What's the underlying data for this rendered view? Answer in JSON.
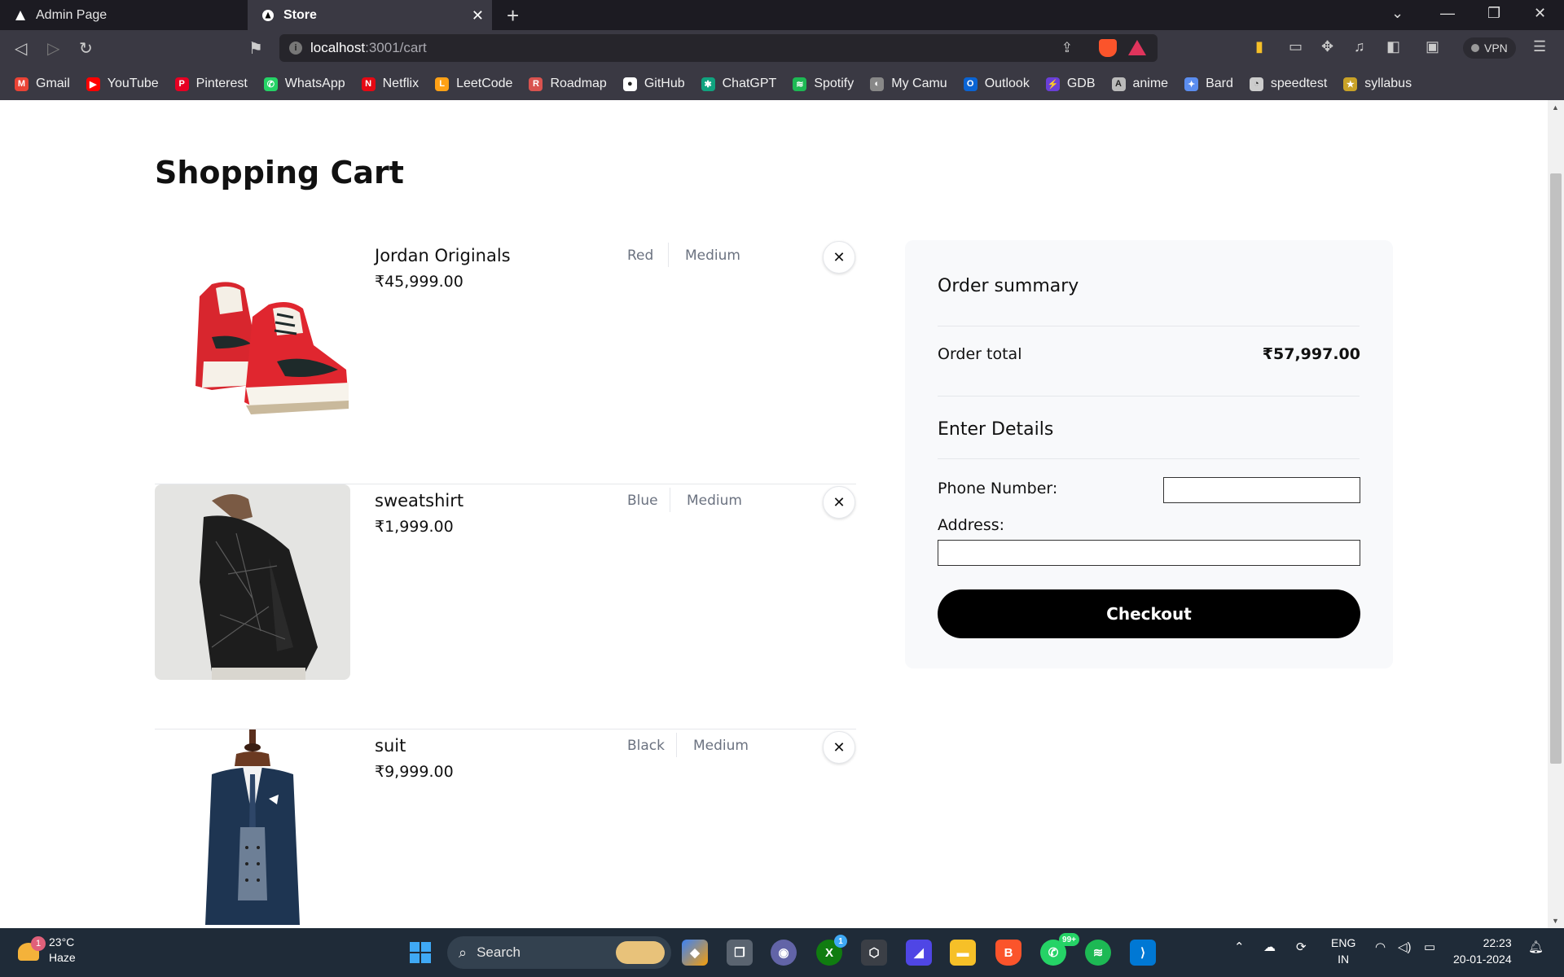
{
  "browser": {
    "tabs": [
      {
        "title": "Admin Page",
        "active": false
      },
      {
        "title": "Store",
        "active": true
      }
    ],
    "url_host": "localhost",
    "url_path": ":3001/cart",
    "vpn_label": "VPN",
    "bookmarks": [
      {
        "label": "Gmail",
        "color": "#ea4335",
        "glyph": "M"
      },
      {
        "label": "YouTube",
        "color": "#ff0000",
        "glyph": "▶"
      },
      {
        "label": "Pinterest",
        "color": "#e60023",
        "glyph": "P"
      },
      {
        "label": "WhatsApp",
        "color": "#25d366",
        "glyph": "✆"
      },
      {
        "label": "Netflix",
        "color": "#e50914",
        "glyph": "N"
      },
      {
        "label": "LeetCode",
        "color": "#ffa116",
        "glyph": "L"
      },
      {
        "label": "Roadmap",
        "color": "#d9534f",
        "glyph": "R"
      },
      {
        "label": "GitHub",
        "color": "#ffffff",
        "glyph": "●"
      },
      {
        "label": "ChatGPT",
        "color": "#10a37f",
        "glyph": "✱"
      },
      {
        "label": "Spotify",
        "color": "#1db954",
        "glyph": "≋"
      },
      {
        "label": "My Camu",
        "color": "#888888",
        "glyph": "◐"
      },
      {
        "label": "Outlook",
        "color": "#0a64d4",
        "glyph": "O"
      },
      {
        "label": "GDB",
        "color": "#6a3fd8",
        "glyph": "⚡"
      },
      {
        "label": "anime",
        "color": "#bbbbbb",
        "glyph": "A"
      },
      {
        "label": "Bard",
        "color": "#5b8def",
        "glyph": "✦"
      },
      {
        "label": "speedtest",
        "color": "#cccccc",
        "glyph": "◔"
      },
      {
        "label": "syllabus",
        "color": "#c9a227",
        "glyph": "★"
      }
    ]
  },
  "page": {
    "title": "Shopping Cart",
    "items": [
      {
        "name": "Jordan Originals",
        "price": "₹45,999.00",
        "color": "Red",
        "size": "Medium",
        "image": "sneakers"
      },
      {
        "name": "sweatshirt",
        "price": "₹1,999.00",
        "color": "Blue",
        "size": "Medium",
        "image": "sweatshirt"
      },
      {
        "name": "suit",
        "price": "₹9,999.00",
        "color": "Black",
        "size": "Medium",
        "image": "suit"
      }
    ],
    "remove_glyph": "✕",
    "summary": {
      "title": "Order summary",
      "total_label": "Order total",
      "total_value": "₹57,997.00",
      "details_title": "Enter Details",
      "phone_label": "Phone Number:",
      "phone_value": "",
      "address_label": "Address:",
      "address_value": "",
      "checkout_label": "Checkout"
    }
  },
  "taskbar": {
    "weather_temp": "23°C",
    "weather_desc": "Haze",
    "weather_badge": "1",
    "search_label": "Search",
    "xbox_badge": "1",
    "whatsapp_badge": "99+",
    "lang_top": "ENG",
    "lang_bottom": "IN",
    "time": "22:23",
    "date": "20-01-2024"
  },
  "colors": {
    "accent": "#000000",
    "tab_active": "#3a3943",
    "taskbar": "#1f2b38"
  }
}
